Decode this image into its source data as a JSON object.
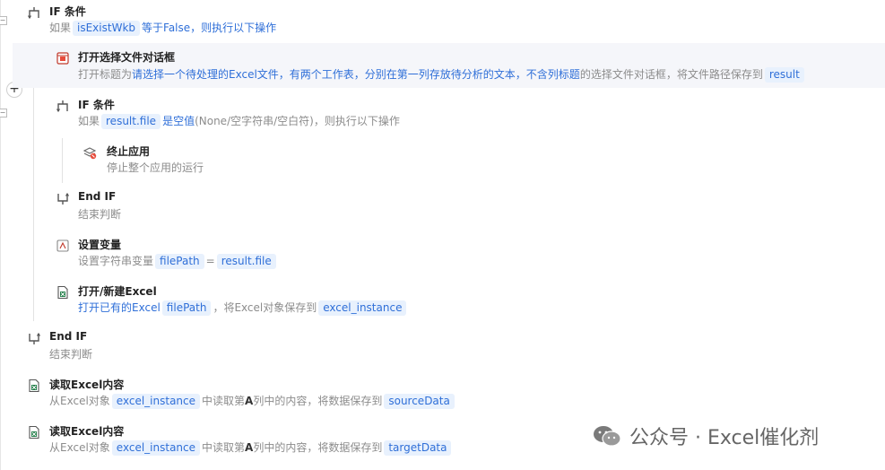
{
  "steps": {
    "if1": {
      "title": "IF 条件",
      "desc": {
        "pre": "如果",
        "var": "isExistWkb",
        "post": "等于False，则执行以下操作"
      }
    },
    "open_dialog": {
      "title": "打开选择文件对话框",
      "desc": {
        "pre": "打开标题为",
        "blue": "请选择一个待处理的Excel文件，有两个工作表，分别在第一列存放待分析的文本，不含列标题",
        "mid": "的选择文件对话框，将文件路径保存到",
        "var": "result"
      }
    },
    "if2": {
      "title": "IF 条件",
      "desc": {
        "pre": "如果",
        "var": "result.file",
        "blue": "是空值",
        "post": "(None/空字符串/空白符)，则执行以下操作"
      }
    },
    "stop": {
      "title": "终止应用",
      "desc": "停止整个应用的运行"
    },
    "endif2": {
      "title": "End IF",
      "desc": "结束判断"
    },
    "set_var": {
      "title": "设置变量",
      "desc": {
        "pre": "设置字符串变量",
        "var1": "filePath",
        "eq": "=",
        "var2": "result.file"
      }
    },
    "open_excel": {
      "title": "打开/新建Excel",
      "desc": {
        "blue": "打开已有的Excel",
        "var1": "filePath",
        "mid": "，将Excel对象保存到",
        "var2": "excel_instance"
      }
    },
    "endif1": {
      "title": "End IF",
      "desc": "结束判断"
    },
    "read1": {
      "title": "读取Excel内容",
      "desc": {
        "pre": "从Excel对象",
        "var1": "excel_instance",
        "mid1": "中读取第",
        "col": "A",
        "mid2": "列中的内容，将数据保存到",
        "var2": "sourceData"
      }
    },
    "read2": {
      "title": "读取Excel内容",
      "desc": {
        "pre": "从Excel对象",
        "var1": "excel_instance",
        "mid1": "中读取第",
        "col": "A",
        "mid2": "列中的内容，将数据保存到",
        "var2": "targetData"
      }
    }
  },
  "gutter": {
    "collapse1": "−",
    "add": "+",
    "collapse2": "−"
  },
  "watermark": "公众号 · Excel催化剂",
  "icons": {
    "if": "if-branch-icon",
    "dialog": "file-dialog-icon",
    "stop": "stop-app-icon",
    "endif": "end-if-icon",
    "variable": "set-variable-icon",
    "excel": "excel-file-icon",
    "wechat": "wechat-logo-icon"
  }
}
